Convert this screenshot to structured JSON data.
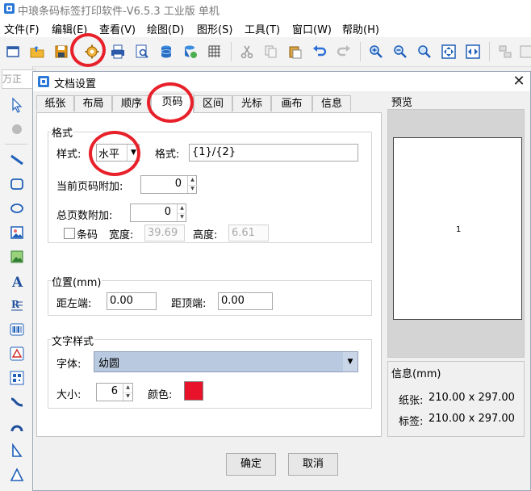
{
  "app": {
    "title": "中琅条码标签打印软件-V6.5.3 工业版 单机"
  },
  "menu": [
    "文件(F)",
    "编辑(E)",
    "查看(V)",
    "绘图(D)",
    "图形(S)",
    "工具(T)",
    "窗口(W)",
    "帮助(H)"
  ],
  "background": {
    "input_text": "万正"
  },
  "dialog": {
    "title": "文档设置",
    "close": "✕",
    "tabs": [
      "纸张",
      "布局",
      "顺序",
      "页码",
      "区间",
      "光标",
      "画布",
      "信息"
    ],
    "active_tab": "页码",
    "format_group": {
      "title": "格式",
      "style_label": "样式:",
      "style_value": "水平",
      "format_label": "格式:",
      "format_value": "{1}/{2}",
      "current_page_label": "当前页码附加:",
      "current_page_value": "0",
      "total_label": "总页数附加:",
      "total_value": "0",
      "barcode_label": "条码",
      "width_label": "宽度:",
      "width_value": "39.69",
      "height_label": "高度:",
      "height_value": "6.61"
    },
    "position_group": {
      "title": "位置(mm)",
      "left_label": "距左端:",
      "left_value": "0.00",
      "top_label": "距顶端:",
      "top_value": "0.00"
    },
    "text_style_group": {
      "title": "文字样式",
      "font_label": "字体:",
      "font_value": "幼圆",
      "size_label": "大小:",
      "size_value": "6",
      "color_label": "颜色:",
      "color_value": "#e8132a"
    },
    "preview": {
      "title": "预览",
      "page_number": "1"
    },
    "info": {
      "title": "信息(mm)",
      "paper_label": "纸张:",
      "paper_value": "210.00 x 297.00",
      "label_label": "标签:",
      "label_value": "210.00 x 297.00"
    },
    "ok": "确定",
    "cancel": "取消"
  },
  "colors": {
    "accent": "#2b6fd6",
    "highlight_circle": "#e8202a",
    "font_select_bg": "#b9c9df"
  }
}
